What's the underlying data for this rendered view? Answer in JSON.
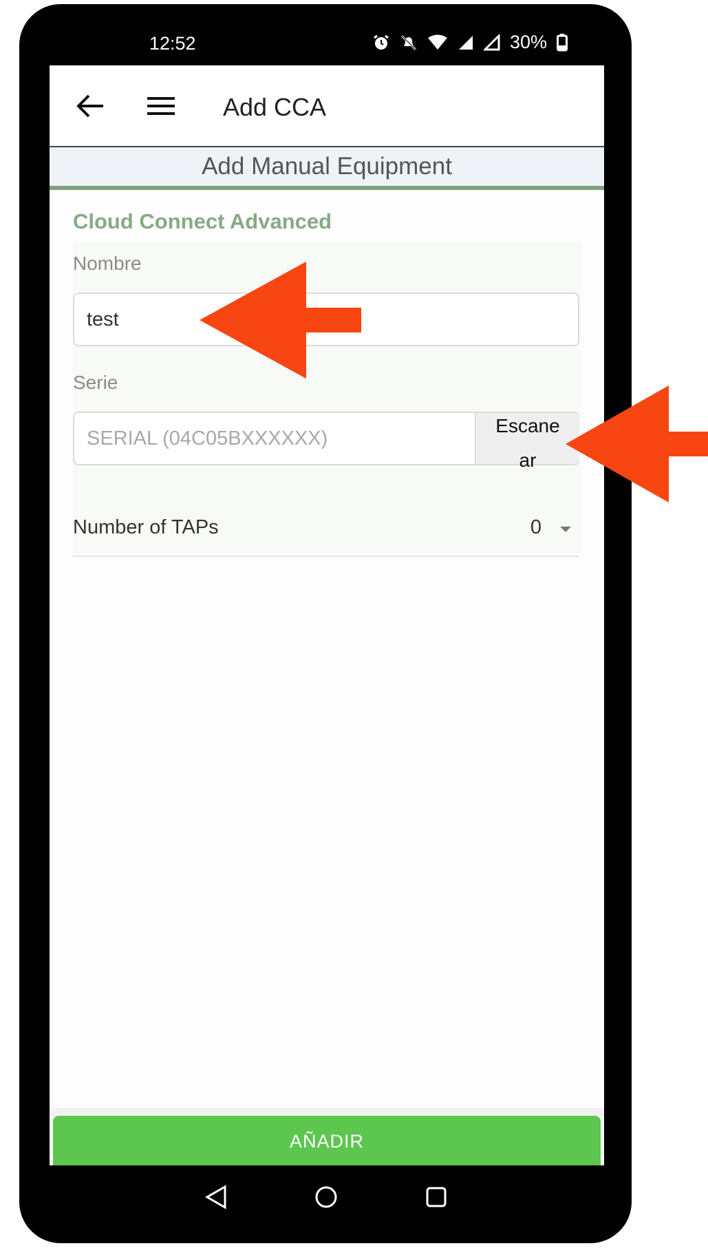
{
  "status_bar": {
    "time": "12:52",
    "battery": "30%",
    "icons": [
      "alarm-icon",
      "notifications-off-icon",
      "wifi-icon",
      "signal-icon",
      "signal-icon",
      "battery-icon"
    ]
  },
  "app_bar": {
    "title": "Add CCA",
    "back_icon": "arrow-left-icon",
    "menu_icon": "hamburger-icon"
  },
  "subheader": {
    "title": "Add Manual Equipment"
  },
  "form": {
    "title": "Cloud Connect Advanced",
    "name": {
      "label": "Nombre",
      "value": "test"
    },
    "serial": {
      "label": "Serie",
      "placeholder": "SERIAL (04C05BXXXXXX)",
      "scan_label": "Escanear"
    },
    "taps": {
      "label": "Number of TAPs",
      "value": "0"
    }
  },
  "footer": {
    "add_label": "AÑADIR"
  },
  "colors": {
    "accent_green": "#5cc64f",
    "title_green": "#87aa85",
    "annotation_arrow": "#f74611"
  }
}
